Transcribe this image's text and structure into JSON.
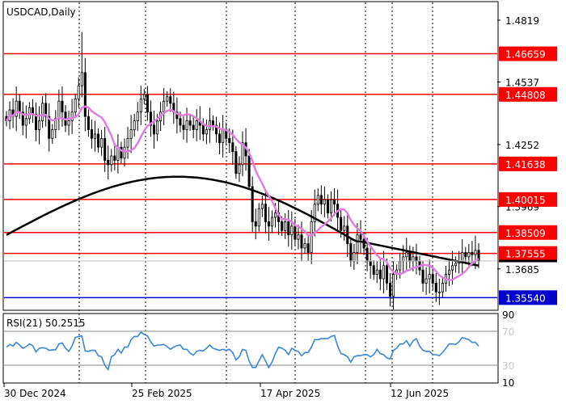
{
  "chart_data": {
    "type": "candlestick",
    "title": "USDCAD,Daily",
    "price_axis": {
      "min": 1.35,
      "max": 1.49,
      "ticks": [
        1.4819,
        1.4537,
        1.4252,
        1.3969,
        1.3685
      ]
    },
    "x_axis": {
      "labels": [
        "30 Dec 2024",
        "25 Feb 2025",
        "17 Apr 2025",
        "12 Jun 2025"
      ]
    },
    "levels": [
      {
        "value": 1.46659,
        "label": "1.46659",
        "color": "#ff0000"
      },
      {
        "value": 1.44808,
        "label": "1.44808",
        "color": "#ff0000"
      },
      {
        "value": 1.41638,
        "label": "1.41638",
        "color": "#ff0000"
      },
      {
        "value": 1.40015,
        "label": "1.40015",
        "color": "#ff0000"
      },
      {
        "value": 1.38509,
        "label": "1.38509",
        "color": "#ff0000"
      },
      {
        "value": 1.37555,
        "label": "1.37555",
        "color": "#ff0000"
      },
      {
        "value": 1.3554,
        "label": "1.35540",
        "color": "#0000cc"
      }
    ],
    "current_price": 1.3721,
    "ma_fast_color": "#e07ee0",
    "ma_slow_color": "#000000",
    "closes": [
      1.436,
      1.441,
      1.438,
      1.445,
      1.44,
      1.434,
      1.437,
      1.442,
      1.439,
      1.432,
      1.436,
      1.444,
      1.438,
      1.428,
      1.432,
      1.437,
      1.445,
      1.44,
      1.434,
      1.436,
      1.44,
      1.446,
      1.452,
      1.458,
      1.438,
      1.432,
      1.428,
      1.43,
      1.424,
      1.428,
      1.418,
      1.416,
      1.42,
      1.418,
      1.424,
      1.419,
      1.424,
      1.428,
      1.432,
      1.436,
      1.44,
      1.446,
      1.448,
      1.44,
      1.434,
      1.43,
      1.436,
      1.44,
      1.445,
      1.447,
      1.444,
      1.44,
      1.437,
      1.434,
      1.432,
      1.436,
      1.434,
      1.432,
      1.436,
      1.434,
      1.43,
      1.432,
      1.436,
      1.434,
      1.43,
      1.426,
      1.432,
      1.428,
      1.426,
      1.422,
      1.412,
      1.416,
      1.426,
      1.42,
      1.406,
      1.39,
      1.388,
      1.396,
      1.398,
      1.39,
      1.388,
      1.392,
      1.394,
      1.39,
      1.386,
      1.39,
      1.384,
      1.388,
      1.382,
      1.384,
      1.378,
      1.38,
      1.376,
      1.39,
      1.398,
      1.402,
      1.398,
      1.4,
      1.394,
      1.4,
      1.398,
      1.392,
      1.386,
      1.388,
      1.38,
      1.372,
      1.376,
      1.384,
      1.382,
      1.378,
      1.372,
      1.37,
      1.366,
      1.368,
      1.364,
      1.37,
      1.362,
      1.356,
      1.366,
      1.368,
      1.372,
      1.374,
      1.376,
      1.372,
      1.374,
      1.372,
      1.368,
      1.362,
      1.364,
      1.366,
      1.362,
      1.358,
      1.358,
      1.362,
      1.366,
      1.368,
      1.37,
      1.371,
      1.372,
      1.376,
      1.374,
      1.376,
      1.375,
      1.377,
      1.372
    ],
    "rsi": {
      "label": "RSI(21) 50.2515",
      "ticks": [
        90,
        70,
        30,
        10
      ],
      "levels": [
        70,
        30
      ],
      "range": [
        10,
        90
      ],
      "color": "#3a87d8"
    }
  }
}
